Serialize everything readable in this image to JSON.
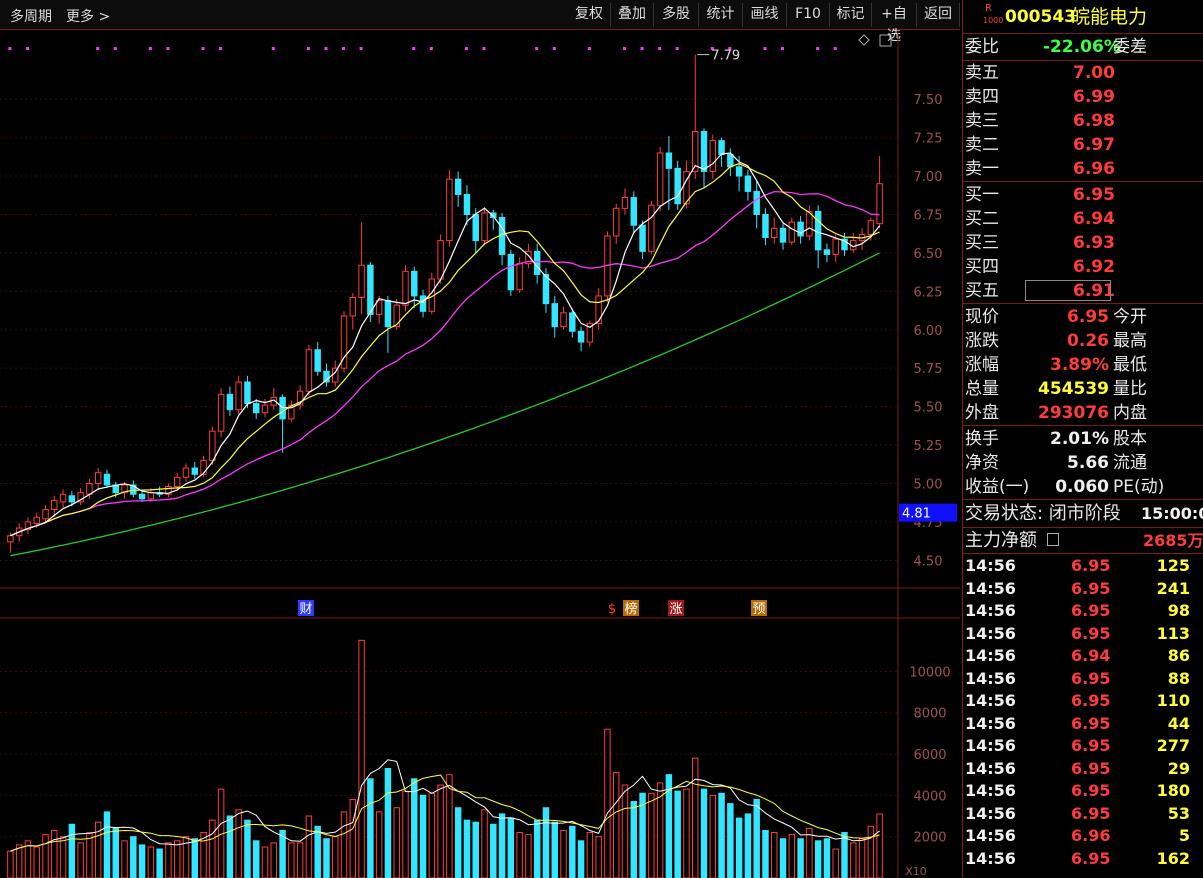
{
  "toolbar": {
    "period_label": "多周期",
    "more_label": "更多 >",
    "buttons": [
      "复权",
      "叠加",
      "多股",
      "统计",
      "画线",
      "F10",
      "标记",
      "+自选",
      "返回"
    ]
  },
  "stock": {
    "badge_top": "R",
    "badge_bottom": "1000",
    "code": "000543",
    "name": "皖能电力"
  },
  "quote": {
    "wei_bi_label": "委比",
    "wei_bi_value": "-22.06%",
    "wei_cha_label": "委差",
    "asks": [
      {
        "label": "卖五",
        "price": "7.00"
      },
      {
        "label": "卖四",
        "price": "6.99"
      },
      {
        "label": "卖三",
        "price": "6.98"
      },
      {
        "label": "卖二",
        "price": "6.97"
      },
      {
        "label": "卖一",
        "price": "6.96"
      }
    ],
    "bids": [
      {
        "label": "买一",
        "price": "6.95"
      },
      {
        "label": "买二",
        "price": "6.94"
      },
      {
        "label": "买三",
        "price": "6.93"
      },
      {
        "label": "买四",
        "price": "6.92"
      },
      {
        "label": "买五",
        "price": "6.91"
      }
    ],
    "stats": [
      {
        "label": "现价",
        "value": "6.95",
        "label2": "今开",
        "color": "red"
      },
      {
        "label": "涨跌",
        "value": "0.26",
        "label2": "最高",
        "color": "red"
      },
      {
        "label": "涨幅",
        "value": "3.89%",
        "label2": "最低",
        "color": "red"
      },
      {
        "label": "总量",
        "value": "454539",
        "label2": "量比",
        "color": "yellow"
      },
      {
        "label": "外盘",
        "value": "293076",
        "label2": "内盘",
        "color": "red"
      }
    ],
    "stats2": [
      {
        "label": "换手",
        "value": "2.01%",
        "label2": "股本"
      },
      {
        "label": "净资",
        "value": "5.66",
        "label2": "流通"
      },
      {
        "label": "收益(一)",
        "value": "0.060",
        "label2": "PE(动)"
      }
    ],
    "trade_status_label": "交易状态: 闭市阶段",
    "trade_time": "15:00:0",
    "main_net_label": "主力净额",
    "main_net_value": "2685万"
  },
  "ticks": [
    {
      "time": "14:56",
      "price": "6.95",
      "vol": "125"
    },
    {
      "time": "14:56",
      "price": "6.95",
      "vol": "241"
    },
    {
      "time": "14:56",
      "price": "6.95",
      "vol": "98"
    },
    {
      "time": "14:56",
      "price": "6.95",
      "vol": "113"
    },
    {
      "time": "14:56",
      "price": "6.94",
      "vol": "86"
    },
    {
      "time": "14:56",
      "price": "6.95",
      "vol": "88"
    },
    {
      "time": "14:56",
      "price": "6.95",
      "vol": "110"
    },
    {
      "time": "14:56",
      "price": "6.95",
      "vol": "44"
    },
    {
      "time": "14:56",
      "price": "6.95",
      "vol": "277"
    },
    {
      "time": "14:56",
      "price": "6.95",
      "vol": "29"
    },
    {
      "time": "14:56",
      "price": "6.95",
      "vol": "180"
    },
    {
      "time": "14:56",
      "price": "6.95",
      "vol": "53"
    },
    {
      "time": "14:56",
      "price": "6.96",
      "vol": "5"
    },
    {
      "time": "14:56",
      "price": "6.95",
      "vol": "162"
    }
  ],
  "chart_data": {
    "type": "candlestick",
    "price_axis": {
      "ticks": [
        "7.50",
        "7.25",
        "7.00",
        "6.75",
        "6.50",
        "6.25",
        "6.00",
        "5.75",
        "5.50",
        "5.25",
        "5.00",
        "4.75",
        "4.50"
      ],
      "min": 4.45,
      "max": 7.82
    },
    "current_price_tag": "4.81",
    "high_marker": "7.79",
    "volume_axis": {
      "ticks": [
        "10000",
        "8000",
        "6000",
        "4000",
        "2000"
      ],
      "max": 12000,
      "unit_label": "X10"
    },
    "event_markers": [
      "财",
      "$",
      "榜",
      "涨",
      "预"
    ],
    "candles": [
      [
        4.62,
        4.66,
        4.55,
        4.68
      ],
      [
        4.66,
        4.71,
        4.62,
        4.74
      ],
      [
        4.7,
        4.75,
        4.67,
        4.78
      ],
      [
        4.74,
        4.78,
        4.71,
        4.81
      ],
      [
        4.77,
        4.83,
        4.74,
        4.86
      ],
      [
        4.83,
        4.89,
        4.78,
        4.92
      ],
      [
        4.88,
        4.93,
        4.84,
        4.96
      ],
      [
        4.92,
        4.88,
        4.85,
        4.95
      ],
      [
        4.88,
        4.94,
        4.86,
        4.97
      ],
      [
        4.93,
        5.0,
        4.9,
        5.03
      ],
      [
        5.0,
        5.07,
        4.96,
        5.1
      ],
      [
        5.06,
        4.99,
        4.97,
        5.09
      ],
      [
        4.99,
        4.94,
        4.91,
        5.01
      ],
      [
        4.94,
        4.99,
        4.9,
        5.01
      ],
      [
        4.99,
        4.93,
        4.91,
        5.02
      ],
      [
        4.93,
        4.9,
        4.88,
        4.96
      ],
      [
        4.9,
        4.94,
        4.88,
        4.97
      ],
      [
        4.94,
        4.93,
        4.91,
        4.98
      ],
      [
        4.93,
        4.98,
        4.91,
        5.0
      ],
      [
        4.98,
        5.04,
        4.95,
        5.07
      ],
      [
        5.04,
        5.1,
        5.01,
        5.13
      ],
      [
        5.1,
        5.06,
        5.03,
        5.14
      ],
      [
        5.06,
        5.15,
        5.04,
        5.18
      ],
      [
        5.15,
        5.34,
        5.12,
        5.37
      ],
      [
        5.34,
        5.58,
        5.3,
        5.62
      ],
      [
        5.58,
        5.48,
        5.44,
        5.63
      ],
      [
        5.48,
        5.66,
        5.45,
        5.7
      ],
      [
        5.66,
        5.52,
        5.49,
        5.7
      ],
      [
        5.52,
        5.46,
        5.42,
        5.55
      ],
      [
        5.46,
        5.51,
        5.43,
        5.55
      ],
      [
        5.51,
        5.56,
        5.48,
        5.62
      ],
      [
        5.56,
        5.42,
        5.2,
        5.58
      ],
      [
        5.42,
        5.51,
        5.4,
        5.54
      ],
      [
        5.51,
        5.6,
        5.48,
        5.64
      ],
      [
        5.6,
        5.87,
        5.57,
        5.9
      ],
      [
        5.87,
        5.73,
        5.7,
        5.92
      ],
      [
        5.73,
        5.66,
        5.63,
        5.78
      ],
      [
        5.66,
        5.75,
        5.63,
        5.8
      ],
      [
        5.75,
        6.09,
        5.72,
        6.12
      ],
      [
        6.09,
        6.21,
        6.0,
        6.24
      ],
      [
        6.21,
        6.42,
        6.1,
        6.7
      ],
      [
        6.42,
        6.1,
        6.05,
        6.44
      ],
      [
        6.1,
        6.19,
        6.04,
        6.22
      ],
      [
        6.19,
        6.02,
        5.85,
        6.22
      ],
      [
        6.02,
        6.16,
        6.0,
        6.2
      ],
      [
        6.16,
        6.38,
        6.12,
        6.42
      ],
      [
        6.38,
        6.22,
        6.14,
        6.41
      ],
      [
        6.22,
        6.12,
        6.08,
        6.26
      ],
      [
        6.12,
        6.33,
        6.1,
        6.37
      ],
      [
        6.33,
        6.58,
        6.3,
        6.62
      ],
      [
        6.58,
        6.98,
        6.54,
        7.04
      ],
      [
        6.98,
        6.88,
        6.8,
        7.03
      ],
      [
        6.88,
        6.75,
        6.68,
        6.94
      ],
      [
        6.75,
        6.58,
        6.5,
        6.79
      ],
      [
        6.58,
        6.76,
        6.55,
        6.8
      ],
      [
        6.76,
        6.73,
        6.65,
        6.78
      ],
      [
        6.73,
        6.49,
        6.42,
        6.76
      ],
      [
        6.49,
        6.26,
        6.22,
        6.52
      ],
      [
        6.26,
        6.43,
        6.24,
        6.47
      ],
      [
        6.43,
        6.51,
        6.4,
        6.56
      ],
      [
        6.51,
        6.36,
        6.3,
        6.56
      ],
      [
        6.36,
        6.17,
        6.11,
        6.4
      ],
      [
        6.17,
        6.02,
        5.95,
        6.22
      ],
      [
        6.02,
        6.11,
        6.0,
        6.15
      ],
      [
        6.11,
        5.99,
        5.95,
        6.14
      ],
      [
        5.99,
        5.92,
        5.86,
        6.02
      ],
      [
        5.92,
        6.04,
        5.89,
        6.06
      ],
      [
        6.04,
        6.22,
        6.0,
        6.27
      ],
      [
        6.22,
        6.61,
        6.18,
        6.64
      ],
      [
        6.61,
        6.79,
        6.56,
        6.82
      ],
      [
        6.79,
        6.86,
        6.75,
        6.92
      ],
      [
        6.86,
        6.68,
        6.63,
        6.9
      ],
      [
        6.68,
        6.51,
        6.46,
        6.71
      ],
      [
        6.51,
        6.81,
        6.49,
        6.84
      ],
      [
        6.81,
        7.15,
        6.77,
        7.19
      ],
      [
        7.15,
        7.05,
        6.78,
        7.26
      ],
      [
        7.05,
        6.82,
        6.78,
        7.1
      ],
      [
        6.82,
        7.03,
        6.79,
        7.1
      ],
      [
        7.03,
        7.29,
        6.98,
        7.79
      ],
      [
        7.29,
        7.03,
        6.92,
        7.31
      ],
      [
        7.03,
        7.23,
        6.98,
        7.27
      ],
      [
        7.23,
        7.14,
        7.06,
        7.25
      ],
      [
        7.14,
        7.06,
        7.0,
        7.18
      ],
      [
        7.06,
        7.0,
        6.9,
        7.13
      ],
      [
        7.0,
        6.9,
        6.84,
        7.04
      ],
      [
        6.9,
        6.75,
        6.66,
        6.97
      ],
      [
        6.75,
        6.6,
        6.55,
        6.79
      ],
      [
        6.6,
        6.66,
        6.56,
        6.73
      ],
      [
        6.66,
        6.57,
        6.52,
        6.69
      ],
      [
        6.57,
        6.7,
        6.55,
        6.73
      ],
      [
        6.7,
        6.61,
        6.56,
        6.74
      ],
      [
        6.61,
        6.77,
        6.58,
        6.81
      ],
      [
        6.77,
        6.52,
        6.4,
        6.81
      ],
      [
        6.52,
        6.49,
        6.44,
        6.56
      ],
      [
        6.49,
        6.59,
        6.44,
        6.62
      ],
      [
        6.59,
        6.52,
        6.48,
        6.63
      ],
      [
        6.52,
        6.58,
        6.5,
        6.63
      ],
      [
        6.58,
        6.62,
        6.52,
        6.66
      ],
      [
        6.62,
        6.71,
        6.58,
        6.73
      ],
      [
        6.69,
        6.95,
        6.66,
        7.13
      ]
    ],
    "volumes": [
      1300,
      1600,
      1800,
      1500,
      2100,
      2300,
      2000,
      2600,
      1700,
      2200,
      2700,
      3200,
      2400,
      1800,
      2000,
      1600,
      1500,
      1400,
      1700,
      1800,
      2000,
      1900,
      2200,
      2800,
      4300,
      3000,
      3300,
      2800,
      1800,
      1500,
      1700,
      2300,
      1700,
      1700,
      3000,
      2500,
      1900,
      2000,
      3200,
      3800,
      11500,
      4800,
      3200,
      5300,
      3400,
      4200,
      4800,
      4000,
      4100,
      4500,
      5000,
      3400,
      2800,
      2700,
      3300,
      2600,
      3100,
      2900,
      2200,
      2100,
      2800,
      3400,
      2700,
      2300,
      2500,
      1800,
      2200,
      2000,
      7200,
      5100,
      4500,
      3700,
      4100,
      4100,
      4600,
      5000,
      4200,
      4300,
      5800,
      4300,
      4000,
      4100,
      3600,
      2900,
      3100,
      3800,
      2300,
      2200,
      1900,
      2100,
      1900,
      2400,
      1800,
      1900,
      1400,
      2200,
      1700,
      1900,
      2500,
      3100
    ],
    "ma_lines": {
      "ma5": "white",
      "ma10": "yellow",
      "ma20": "magenta",
      "ma60": "green"
    }
  }
}
